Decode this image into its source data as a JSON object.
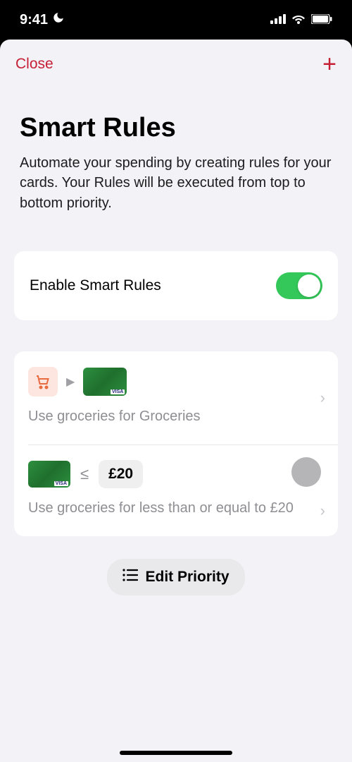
{
  "status": {
    "time": "9:41"
  },
  "nav": {
    "close": "Close"
  },
  "header": {
    "title": "Smart Rules",
    "subtitle": "Automate your spending by creating rules for your cards. Your Rules will be executed from top to bottom priority."
  },
  "enable": {
    "label": "Enable Smart Rules",
    "on": true
  },
  "rules": [
    {
      "desc": "Use groceries for Groceries"
    },
    {
      "operator": "≤",
      "amount": "£20",
      "desc": "Use groceries for less than or equal to £20"
    }
  ],
  "editPriority": "Edit Priority"
}
